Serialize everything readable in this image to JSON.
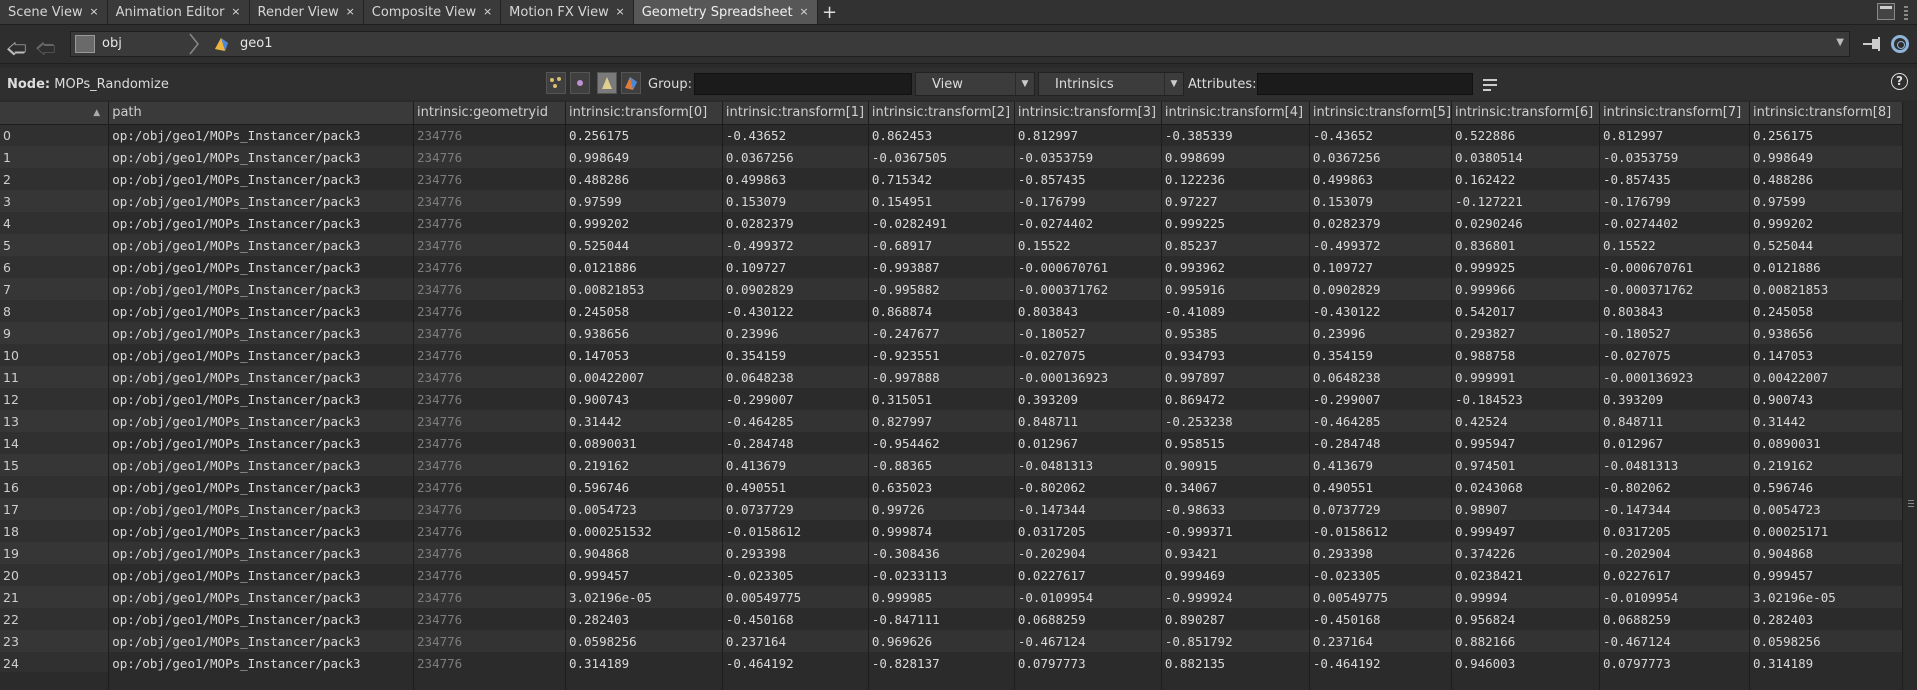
{
  "tabs": [
    {
      "label": "Scene View",
      "active": false
    },
    {
      "label": "Animation Editor",
      "active": false
    },
    {
      "label": "Render View",
      "active": false
    },
    {
      "label": "Composite View",
      "active": false
    },
    {
      "label": "Motion FX View",
      "active": false
    },
    {
      "label": "Geometry Spreadsheet",
      "active": true
    }
  ],
  "tab_close_glyph": "×",
  "tab_add_glyph": "+",
  "path": {
    "root": "obj",
    "node": "geo1"
  },
  "node": {
    "prefix": "Node:",
    "name": "MOPs_Randomize"
  },
  "toolbar": {
    "group_label": "Group:",
    "view_label": "View",
    "intrinsics_label": "Intrinsics",
    "attributes_label": "Attributes:",
    "help_glyph": "?"
  },
  "columns": [
    "",
    "path",
    "intrinsic:geometryid",
    "intrinsic:transform[0]",
    "intrinsic:transform[1]",
    "intrinsic:transform[2]",
    "intrinsic:transform[3]",
    "intrinsic:transform[4]",
    "intrinsic:transform[5]",
    "intrinsic:transform[6]",
    "intrinsic:transform[7]",
    "intrinsic:transform[8]"
  ],
  "rows": [
    [
      "0",
      "op:/obj/geo1/MOPs_Instancer/pack3",
      "234776",
      "0.256175",
      "-0.43652",
      "0.862453",
      "0.812997",
      "-0.385339",
      "-0.43652",
      "0.522886",
      "0.812997",
      "0.256175"
    ],
    [
      "1",
      "op:/obj/geo1/MOPs_Instancer/pack3",
      "234776",
      "0.998649",
      "0.0367256",
      "-0.0367505",
      "-0.0353759",
      "0.998699",
      "0.0367256",
      "0.0380514",
      "-0.0353759",
      "0.998649"
    ],
    [
      "2",
      "op:/obj/geo1/MOPs_Instancer/pack3",
      "234776",
      "0.488286",
      "0.499863",
      "0.715342",
      "-0.857435",
      "0.122236",
      "0.499863",
      "0.162422",
      "-0.857435",
      "0.488286"
    ],
    [
      "3",
      "op:/obj/geo1/MOPs_Instancer/pack3",
      "234776",
      "0.97599",
      "0.153079",
      "0.154951",
      "-0.176799",
      "0.97227",
      "0.153079",
      "-0.127221",
      "-0.176799",
      "0.97599"
    ],
    [
      "4",
      "op:/obj/geo1/MOPs_Instancer/pack3",
      "234776",
      "0.999202",
      "0.0282379",
      "-0.0282491",
      "-0.0274402",
      "0.999225",
      "0.0282379",
      "0.0290246",
      "-0.0274402",
      "0.999202"
    ],
    [
      "5",
      "op:/obj/geo1/MOPs_Instancer/pack3",
      "234776",
      "0.525044",
      "-0.499372",
      "-0.68917",
      "0.15522",
      "0.85237",
      "-0.499372",
      "0.836801",
      "0.15522",
      "0.525044"
    ],
    [
      "6",
      "op:/obj/geo1/MOPs_Instancer/pack3",
      "234776",
      "0.0121886",
      "0.109727",
      "-0.993887",
      "-0.000670761",
      "0.993962",
      "0.109727",
      "0.999925",
      "-0.000670761",
      "0.0121886"
    ],
    [
      "7",
      "op:/obj/geo1/MOPs_Instancer/pack3",
      "234776",
      "0.00821853",
      "0.0902829",
      "-0.995882",
      "-0.000371762",
      "0.995916",
      "0.0902829",
      "0.999966",
      "-0.000371762",
      "0.00821853"
    ],
    [
      "8",
      "op:/obj/geo1/MOPs_Instancer/pack3",
      "234776",
      "0.245058",
      "-0.430122",
      "0.868874",
      "0.803843",
      "-0.41089",
      "-0.430122",
      "0.542017",
      "0.803843",
      "0.245058"
    ],
    [
      "9",
      "op:/obj/geo1/MOPs_Instancer/pack3",
      "234776",
      "0.938656",
      "0.23996",
      "-0.247677",
      "-0.180527",
      "0.95385",
      "0.23996",
      "0.293827",
      "-0.180527",
      "0.938656"
    ],
    [
      "10",
      "op:/obj/geo1/MOPs_Instancer/pack3",
      "234776",
      "0.147053",
      "0.354159",
      "-0.923551",
      "-0.027075",
      "0.934793",
      "0.354159",
      "0.988758",
      "-0.027075",
      "0.147053"
    ],
    [
      "11",
      "op:/obj/geo1/MOPs_Instancer/pack3",
      "234776",
      "0.00422007",
      "0.0648238",
      "-0.997888",
      "-0.000136923",
      "0.997897",
      "0.0648238",
      "0.999991",
      "-0.000136923",
      "0.00422007"
    ],
    [
      "12",
      "op:/obj/geo1/MOPs_Instancer/pack3",
      "234776",
      "0.900743",
      "-0.299007",
      "0.315051",
      "0.393209",
      "0.869472",
      "-0.299007",
      "-0.184523",
      "0.393209",
      "0.900743"
    ],
    [
      "13",
      "op:/obj/geo1/MOPs_Instancer/pack3",
      "234776",
      "0.31442",
      "-0.464285",
      "0.827997",
      "0.848711",
      "-0.253238",
      "-0.464285",
      "0.42524",
      "0.848711",
      "0.31442"
    ],
    [
      "14",
      "op:/obj/geo1/MOPs_Instancer/pack3",
      "234776",
      "0.0890031",
      "-0.284748",
      "-0.954462",
      "0.012967",
      "0.958515",
      "-0.284748",
      "0.995947",
      "0.012967",
      "0.0890031"
    ],
    [
      "15",
      "op:/obj/geo1/MOPs_Instancer/pack3",
      "234776",
      "0.219162",
      "0.413679",
      "-0.88365",
      "-0.0481313",
      "0.90915",
      "0.413679",
      "0.974501",
      "-0.0481313",
      "0.219162"
    ],
    [
      "16",
      "op:/obj/geo1/MOPs_Instancer/pack3",
      "234776",
      "0.596746",
      "0.490551",
      "0.635023",
      "-0.802062",
      "0.34067",
      "0.490551",
      "0.0243068",
      "-0.802062",
      "0.596746"
    ],
    [
      "17",
      "op:/obj/geo1/MOPs_Instancer/pack3",
      "234776",
      "0.0054723",
      "0.0737729",
      "0.99726",
      "-0.147344",
      "-0.98633",
      "0.0737729",
      "0.98907",
      "-0.147344",
      "0.0054723"
    ],
    [
      "18",
      "op:/obj/geo1/MOPs_Instancer/pack3",
      "234776",
      "0.000251532",
      "-0.0158612",
      "0.999874",
      "0.0317205",
      "-0.999371",
      "-0.0158612",
      "0.999497",
      "0.0317205",
      "0.00025171"
    ],
    [
      "19",
      "op:/obj/geo1/MOPs_Instancer/pack3",
      "234776",
      "0.904868",
      "0.293398",
      "-0.308436",
      "-0.202904",
      "0.93421",
      "0.293398",
      "0.374226",
      "-0.202904",
      "0.904868"
    ],
    [
      "20",
      "op:/obj/geo1/MOPs_Instancer/pack3",
      "234776",
      "0.999457",
      "-0.023305",
      "-0.0233113",
      "0.0227617",
      "0.999469",
      "-0.023305",
      "0.0238421",
      "0.0227617",
      "0.999457"
    ],
    [
      "21",
      "op:/obj/geo1/MOPs_Instancer/pack3",
      "234776",
      "3.02196e-05",
      "0.00549775",
      "0.999985",
      "-0.0109954",
      "-0.999924",
      "0.00549775",
      "0.99994",
      "-0.0109954",
      "3.02196e-05"
    ],
    [
      "22",
      "op:/obj/geo1/MOPs_Instancer/pack3",
      "234776",
      "0.282403",
      "-0.450168",
      "-0.847111",
      "0.0688259",
      "0.890287",
      "-0.450168",
      "0.956824",
      "0.0688259",
      "0.282403"
    ],
    [
      "23",
      "op:/obj/geo1/MOPs_Instancer/pack3",
      "234776",
      "0.0598256",
      "0.237164",
      "0.969626",
      "-0.467124",
      "-0.851792",
      "0.237164",
      "0.882166",
      "-0.467124",
      "0.0598256"
    ],
    [
      "24",
      "op:/obj/geo1/MOPs_Instancer/pack3",
      "234776",
      "0.314189",
      "-0.464192",
      "-0.828137",
      "0.0797773",
      "0.882135",
      "-0.464192",
      "0.946003",
      "0.0797773",
      "0.314189"
    ]
  ]
}
